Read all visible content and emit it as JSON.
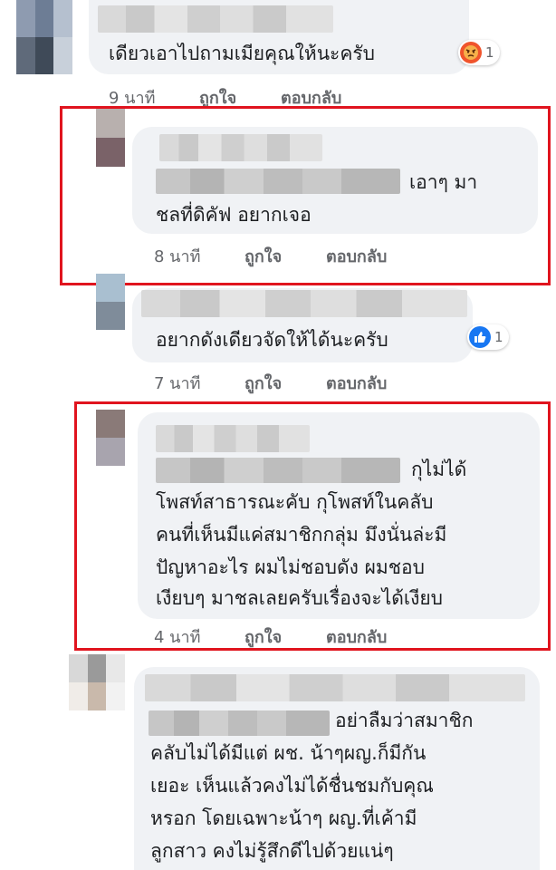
{
  "comments": [
    {
      "text_lines": [
        "เดียวเอาไปถามเมียคุณให้นะครับ"
      ],
      "time": "9 นาที",
      "like_label": "ถูกใจ",
      "reply_label": "ตอบกลับ",
      "reaction": {
        "icon": "angry-face-icon",
        "count": "1",
        "color": "#f0542c"
      }
    },
    {
      "text_lines": [
        "เอาๆ มา",
        "ชลที่ดิคัฟ อยากเจอ"
      ],
      "time": "8 นาที",
      "like_label": "ถูกใจ",
      "reply_label": "ตอบกลับ"
    },
    {
      "text_lines": [
        "อยากดังเดียวจัดให้ได้นะครับ"
      ],
      "time": "7 นาที",
      "like_label": "ถูกใจ",
      "reply_label": "ตอบกลับ",
      "reaction": {
        "icon": "thumbs-up-icon",
        "count": "1",
        "color": "#1877f2"
      }
    },
    {
      "text_lines": [
        "กุไม่ได้",
        "โพสท์สาธารณะคับ กุโพสท์ในคลับ",
        "คนที่เห็นมีแค่สมาชิกกลุ่ม มึงนั่นล่ะมี",
        "ปัญหาอะไร ผมไม่ชอบดัง ผมชอบ",
        "เงียบๆ มาชลเลยครับเรื่องจะได้เงียบ"
      ],
      "time": "4 นาที",
      "like_label": "ถูกใจ",
      "reply_label": "ตอบกลับ"
    },
    {
      "text_lines": [
        "อย่าลืมว่าสมาชิก",
        "คลับไม่ได้มีแต่ ผช. น้าๆผญ.ก็มีกัน",
        "เยอะ เห็นแล้วคงไม่ได้ชื่นชมกับคุณ",
        "หรอก โดยเฉพาะน้าๆ ผญ.ที่เค้ามี",
        "ลูกสาว คงไม่รู้สึกดีไปด้วยแน่ๆ"
      ]
    }
  ],
  "colors": {
    "highlight": "#e0141e",
    "bubble": "#f0f2f5",
    "meta": "#65676b"
  }
}
